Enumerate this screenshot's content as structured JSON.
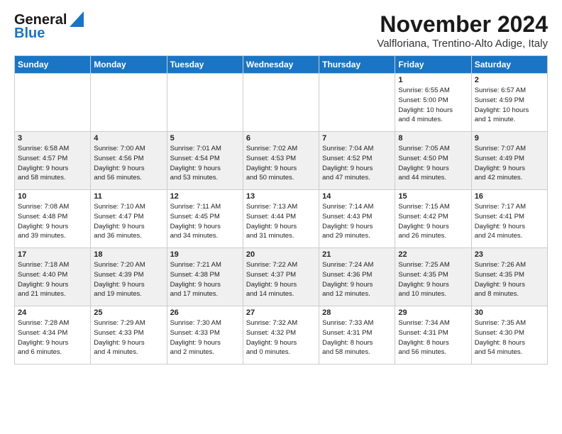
{
  "logo": {
    "line1": "General",
    "line2": "Blue"
  },
  "title": "November 2024",
  "location": "Valfloriana, Trentino-Alto Adige, Italy",
  "weekdays": [
    "Sunday",
    "Monday",
    "Tuesday",
    "Wednesday",
    "Thursday",
    "Friday",
    "Saturday"
  ],
  "weeks": [
    [
      {
        "day": "",
        "info": ""
      },
      {
        "day": "",
        "info": ""
      },
      {
        "day": "",
        "info": ""
      },
      {
        "day": "",
        "info": ""
      },
      {
        "day": "",
        "info": ""
      },
      {
        "day": "1",
        "info": "Sunrise: 6:55 AM\nSunset: 5:00 PM\nDaylight: 10 hours\nand 4 minutes."
      },
      {
        "day": "2",
        "info": "Sunrise: 6:57 AM\nSunset: 4:59 PM\nDaylight: 10 hours\nand 1 minute."
      }
    ],
    [
      {
        "day": "3",
        "info": "Sunrise: 6:58 AM\nSunset: 4:57 PM\nDaylight: 9 hours\nand 58 minutes."
      },
      {
        "day": "4",
        "info": "Sunrise: 7:00 AM\nSunset: 4:56 PM\nDaylight: 9 hours\nand 56 minutes."
      },
      {
        "day": "5",
        "info": "Sunrise: 7:01 AM\nSunset: 4:54 PM\nDaylight: 9 hours\nand 53 minutes."
      },
      {
        "day": "6",
        "info": "Sunrise: 7:02 AM\nSunset: 4:53 PM\nDaylight: 9 hours\nand 50 minutes."
      },
      {
        "day": "7",
        "info": "Sunrise: 7:04 AM\nSunset: 4:52 PM\nDaylight: 9 hours\nand 47 minutes."
      },
      {
        "day": "8",
        "info": "Sunrise: 7:05 AM\nSunset: 4:50 PM\nDaylight: 9 hours\nand 44 minutes."
      },
      {
        "day": "9",
        "info": "Sunrise: 7:07 AM\nSunset: 4:49 PM\nDaylight: 9 hours\nand 42 minutes."
      }
    ],
    [
      {
        "day": "10",
        "info": "Sunrise: 7:08 AM\nSunset: 4:48 PM\nDaylight: 9 hours\nand 39 minutes."
      },
      {
        "day": "11",
        "info": "Sunrise: 7:10 AM\nSunset: 4:47 PM\nDaylight: 9 hours\nand 36 minutes."
      },
      {
        "day": "12",
        "info": "Sunrise: 7:11 AM\nSunset: 4:45 PM\nDaylight: 9 hours\nand 34 minutes."
      },
      {
        "day": "13",
        "info": "Sunrise: 7:13 AM\nSunset: 4:44 PM\nDaylight: 9 hours\nand 31 minutes."
      },
      {
        "day": "14",
        "info": "Sunrise: 7:14 AM\nSunset: 4:43 PM\nDaylight: 9 hours\nand 29 minutes."
      },
      {
        "day": "15",
        "info": "Sunrise: 7:15 AM\nSunset: 4:42 PM\nDaylight: 9 hours\nand 26 minutes."
      },
      {
        "day": "16",
        "info": "Sunrise: 7:17 AM\nSunset: 4:41 PM\nDaylight: 9 hours\nand 24 minutes."
      }
    ],
    [
      {
        "day": "17",
        "info": "Sunrise: 7:18 AM\nSunset: 4:40 PM\nDaylight: 9 hours\nand 21 minutes."
      },
      {
        "day": "18",
        "info": "Sunrise: 7:20 AM\nSunset: 4:39 PM\nDaylight: 9 hours\nand 19 minutes."
      },
      {
        "day": "19",
        "info": "Sunrise: 7:21 AM\nSunset: 4:38 PM\nDaylight: 9 hours\nand 17 minutes."
      },
      {
        "day": "20",
        "info": "Sunrise: 7:22 AM\nSunset: 4:37 PM\nDaylight: 9 hours\nand 14 minutes."
      },
      {
        "day": "21",
        "info": "Sunrise: 7:24 AM\nSunset: 4:36 PM\nDaylight: 9 hours\nand 12 minutes."
      },
      {
        "day": "22",
        "info": "Sunrise: 7:25 AM\nSunset: 4:35 PM\nDaylight: 9 hours\nand 10 minutes."
      },
      {
        "day": "23",
        "info": "Sunrise: 7:26 AM\nSunset: 4:35 PM\nDaylight: 9 hours\nand 8 minutes."
      }
    ],
    [
      {
        "day": "24",
        "info": "Sunrise: 7:28 AM\nSunset: 4:34 PM\nDaylight: 9 hours\nand 6 minutes."
      },
      {
        "day": "25",
        "info": "Sunrise: 7:29 AM\nSunset: 4:33 PM\nDaylight: 9 hours\nand 4 minutes."
      },
      {
        "day": "26",
        "info": "Sunrise: 7:30 AM\nSunset: 4:33 PM\nDaylight: 9 hours\nand 2 minutes."
      },
      {
        "day": "27",
        "info": "Sunrise: 7:32 AM\nSunset: 4:32 PM\nDaylight: 9 hours\nand 0 minutes."
      },
      {
        "day": "28",
        "info": "Sunrise: 7:33 AM\nSunset: 4:31 PM\nDaylight: 8 hours\nand 58 minutes."
      },
      {
        "day": "29",
        "info": "Sunrise: 7:34 AM\nSunset: 4:31 PM\nDaylight: 8 hours\nand 56 minutes."
      },
      {
        "day": "30",
        "info": "Sunrise: 7:35 AM\nSunset: 4:30 PM\nDaylight: 8 hours\nand 54 minutes."
      }
    ]
  ]
}
